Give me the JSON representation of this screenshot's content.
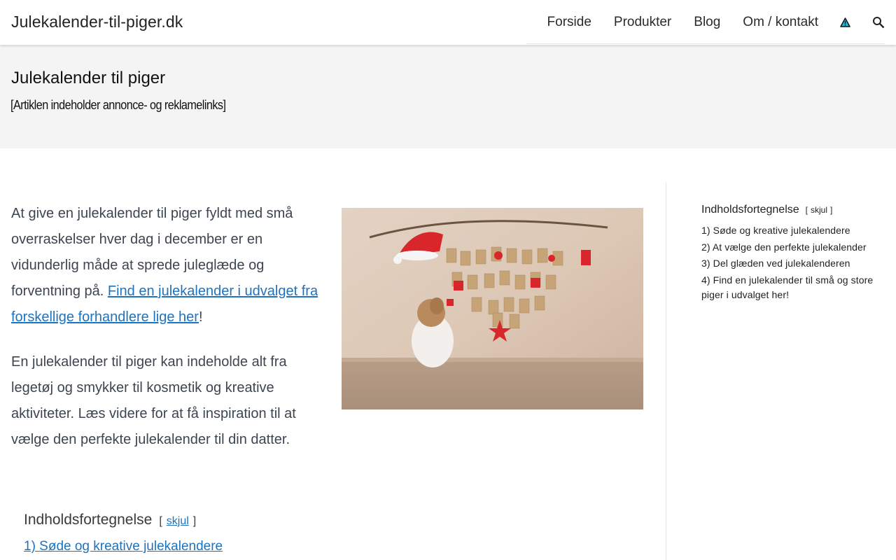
{
  "header": {
    "site_title": "Julekalender-til-piger.dk",
    "nav": [
      {
        "label": "Forside"
      },
      {
        "label": "Produkter"
      },
      {
        "label": "Blog"
      },
      {
        "label": "Om / kontakt"
      }
    ],
    "icons": [
      "warning-icon",
      "search-icon"
    ]
  },
  "hero": {
    "title": "Julekalender til piger",
    "note": "[Artiklen indeholder annonce- og reklamelinks]"
  },
  "content": {
    "p1_text": "At give en julekalender til piger fyldt med små overraskelser hver dag i december er en vidunderlig måde at sprede juleglæde og forventning på. ",
    "p1_link": "Find en julekalender i udvalget fra forskellige forhandlere lige her",
    "p1_end": "!",
    "p2_text": "En julekalender til piger kan indeholde alt fra legetøj og smykker til kosmetik og kreative aktiviteter. Læs videre for at få inspiration til at vælge den perfekte julekalender til din datter."
  },
  "sidebar_toc": {
    "title": "Indholdsfortegnelse",
    "bracket_open": "[",
    "toggle": "skjul",
    "bracket_close": "]",
    "items": [
      {
        "label": "1) Søde og kreative julekalendere"
      },
      {
        "label": "2) At vælge den perfekte julekalender"
      },
      {
        "label": "3) Del glæden ved julekalenderen"
      },
      {
        "label": "4) Find en julekalender til små og store piger i udvalget her!"
      }
    ]
  },
  "content_toc": {
    "title": "Indholdsfortegnelse",
    "bracket_open": "[",
    "toggle": "skjul",
    "bracket_close": "]",
    "items": [
      {
        "label": "1) Søde og kreative julekalendere"
      }
    ]
  },
  "colors": {
    "link": "#1e73be",
    "hero_bg": "#f4f4f4",
    "warning_icon": "#2bb6d8"
  }
}
